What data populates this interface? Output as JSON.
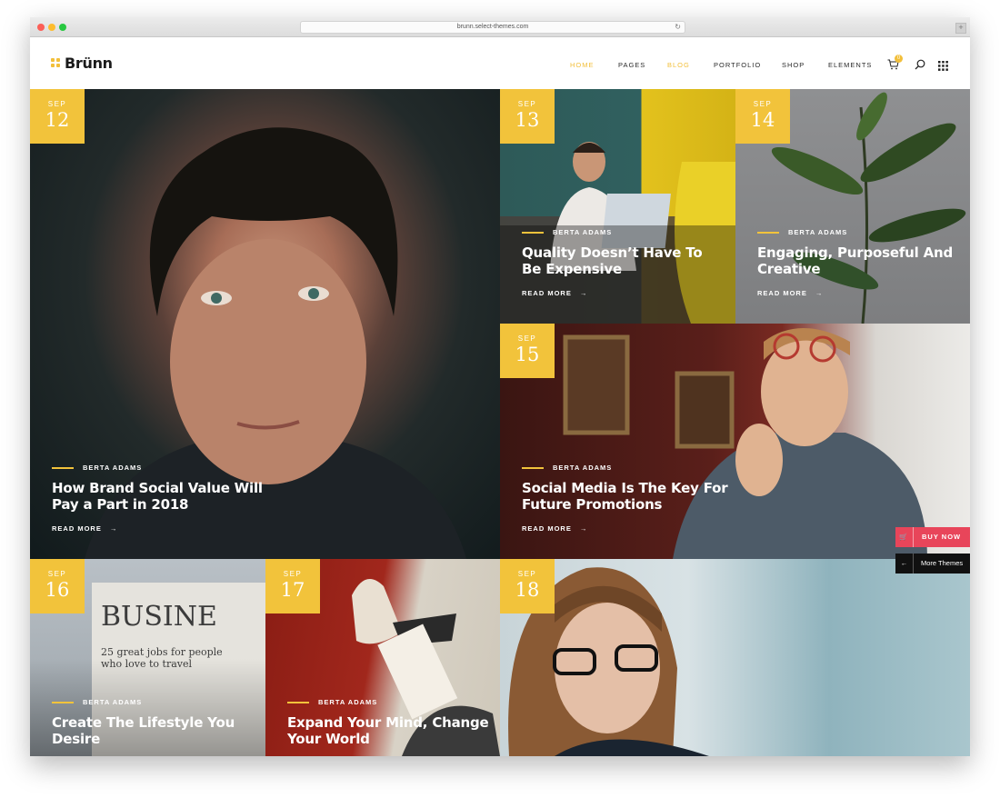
{
  "browser": {
    "url": "brunn.select-themes.com",
    "reload_icon": "reload-icon",
    "newtab_label": "+"
  },
  "site": {
    "logo": "Brünn"
  },
  "nav": [
    {
      "label": "HOME",
      "active": true
    },
    {
      "label": "PAGES",
      "active": false
    },
    {
      "label": "BLOG",
      "active": true
    },
    {
      "label": "PORTFOLIO",
      "active": false
    },
    {
      "label": "SHOP",
      "active": false
    },
    {
      "label": "ELEMENTS",
      "active": false
    }
  ],
  "cart": {
    "count": "0"
  },
  "colors": {
    "accent": "#f2c33b",
    "buy": "#e8455a"
  },
  "read_more_label": "READ MORE",
  "posts": [
    {
      "month": "SEP",
      "day": "12",
      "author": "BERTA ADAMS",
      "title": "How Brand Social Value Will Pay a Part in 2018"
    },
    {
      "month": "SEP",
      "day": "13",
      "author": "BERTA ADAMS",
      "title": "Quality Doesn’t Have To Be Expensive"
    },
    {
      "month": "SEP",
      "day": "14",
      "author": "BERTA ADAMS",
      "title": "Engaging, Purposeful And Creative"
    },
    {
      "month": "SEP",
      "day": "15",
      "author": "BERTA ADAMS",
      "title": "Social Media Is The Key For Future Promotions"
    },
    {
      "month": "SEP",
      "day": "16",
      "author": "BERTA ADAMS",
      "title": "Create The Lifestyle You Desire",
      "newspaper_headline": "BUSINE",
      "newspaper_sub": "25 great jobs for people who love to travel"
    },
    {
      "month": "SEP",
      "day": "17",
      "author": "BERTA ADAMS",
      "title": "Expand Your Mind, Change Your World"
    },
    {
      "month": "SEP",
      "day": "18"
    }
  ],
  "side": {
    "buy_label": "BUY NOW",
    "more_label": "More Themes"
  }
}
